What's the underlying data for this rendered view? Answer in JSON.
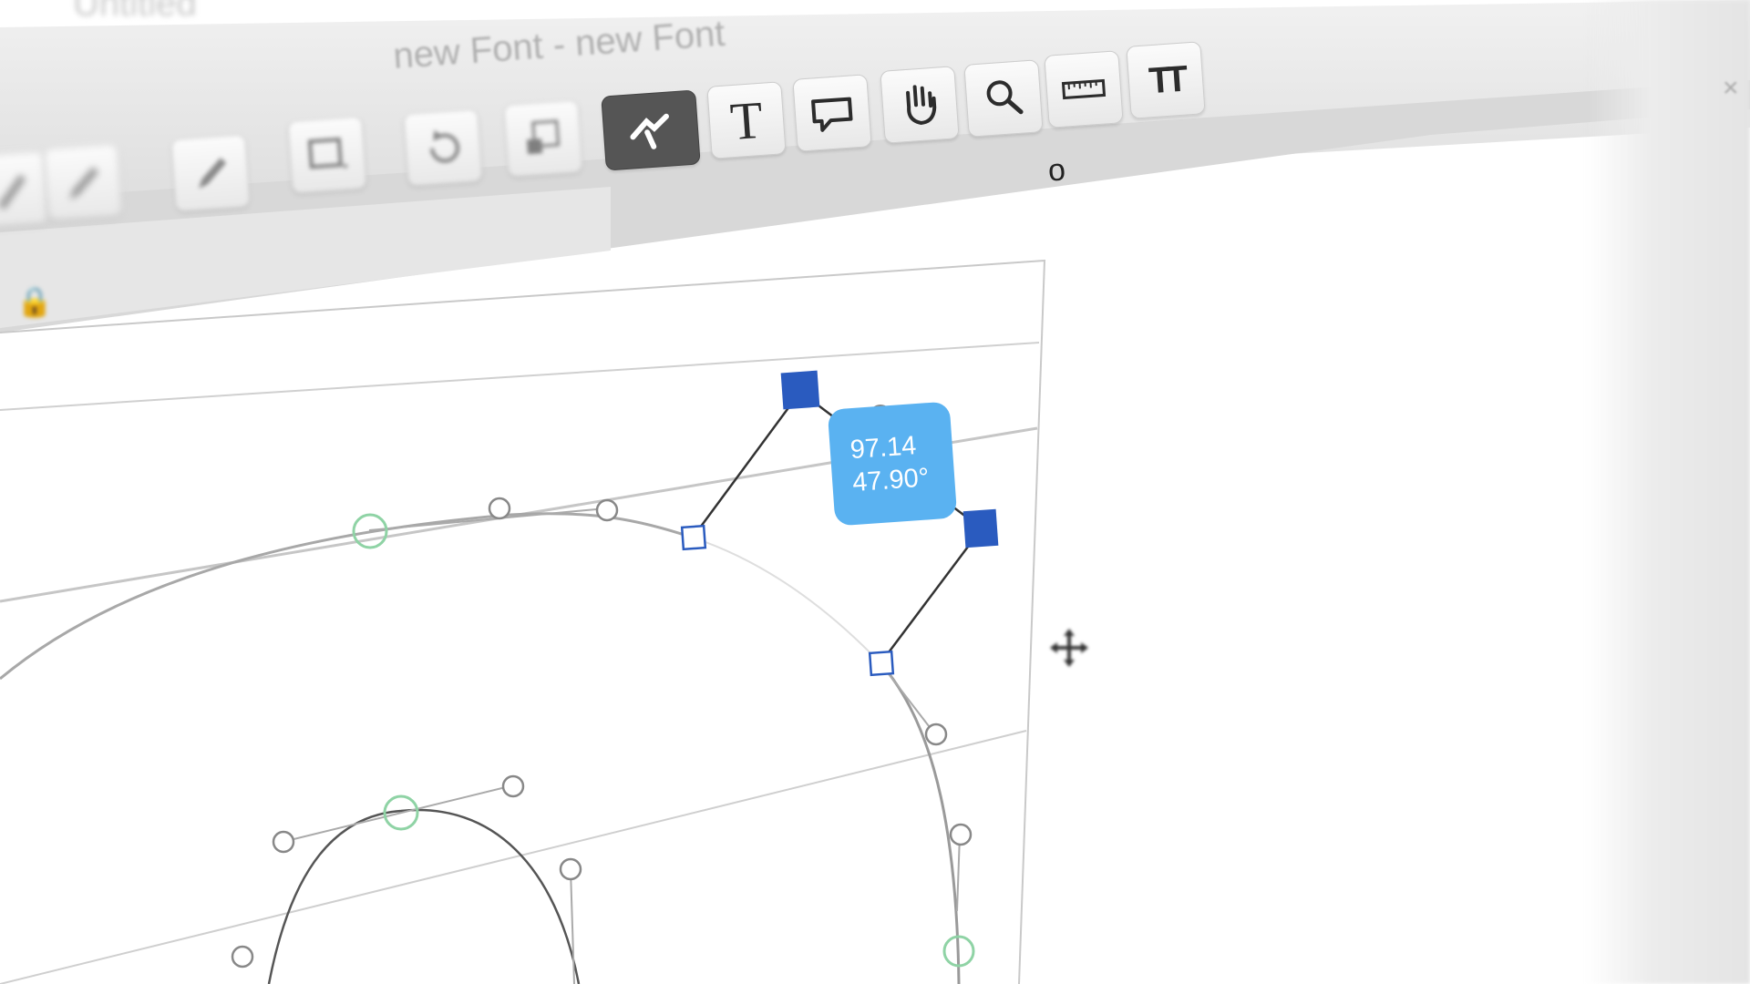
{
  "window": {
    "title": "new Font - new Font",
    "top_tab": "Untitled"
  },
  "toolbar": {
    "tools": [
      {
        "name": "pen-tool",
        "icon": "pen-icon"
      },
      {
        "name": "pencil-tool",
        "icon": "pencil-icon"
      },
      {
        "name": "rectangle-tool",
        "icon": "rectangle-icon"
      },
      {
        "name": "rotate-tool",
        "icon": "rotate-icon"
      },
      {
        "name": "scale-tool",
        "icon": "scale-icon"
      },
      {
        "name": "knife-tool",
        "icon": "knife-icon",
        "active": true
      },
      {
        "name": "text-tool",
        "icon": "text-icon",
        "label": "T"
      },
      {
        "name": "annotation-tool",
        "icon": "speech-bubble-icon"
      },
      {
        "name": "hand-tool",
        "icon": "hand-icon"
      },
      {
        "name": "zoom-tool",
        "icon": "magnifier-icon"
      },
      {
        "name": "measurement-tool",
        "icon": "ruler-icon"
      },
      {
        "name": "font-size-tool",
        "icon": "text-size-icon",
        "label": "TT"
      }
    ]
  },
  "glyph_tab": {
    "value": "o"
  },
  "canvas": {
    "measurement": {
      "distance": "97.14",
      "angle": "47.90°"
    }
  },
  "colors": {
    "accent": "#5ab2f1",
    "node_selected": "#2a5bbf",
    "node_smooth": "#7fcf9a",
    "active_tool": "#555555"
  }
}
